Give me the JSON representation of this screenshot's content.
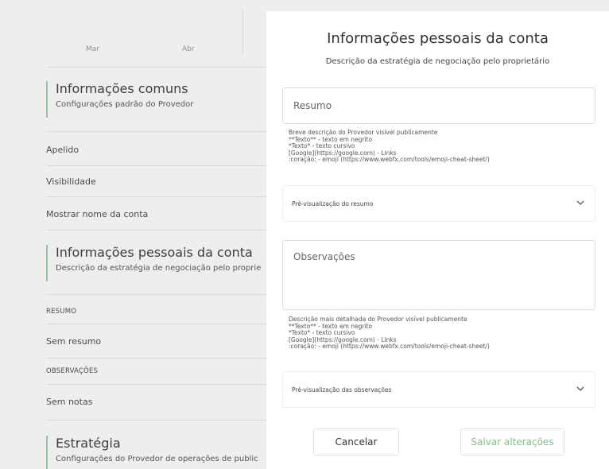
{
  "background": {
    "months": [
      "Mar",
      "Abr"
    ],
    "common": {
      "title": "Informações comuns",
      "subtitle": "Configurações padrão do Provedor"
    },
    "rows": [
      "Apelido",
      "Visibilidade",
      "Mostrar nome da conta"
    ],
    "personal": {
      "title": "Informações pessoais da conta",
      "subtitle": "Descrição da estratégia de negociação pelo proprie"
    },
    "resumo_label": "RESUMO",
    "resumo_value": "Sem resumo",
    "obs_label": "OBSERVAÇÕES",
    "obs_value": "Sem notas",
    "strategy": {
      "title": "Estratégia",
      "subtitle": "Configurações do Provedor de operações de public"
    }
  },
  "modal": {
    "title": "Informações pessoais da conta",
    "subtitle": "Descrição da estratégia de negociação pelo proprietário",
    "summary_placeholder": "Resumo",
    "summary_help": [
      "Breve descrição do Provedor visível publicamente",
      "**Texto** - texto em negrito",
      "*Texto* - texto cursivo",
      "[Google](https://google.com) - Links",
      ":coração: - emoji (https://www.webfx.com/tools/emoji-cheat-sheet/)"
    ],
    "summary_preview": "Pré-visualização do resumo",
    "notes_placeholder": "Observações",
    "notes_help": [
      "Descrição mais detalhada do Provedor visível publicamente",
      "**Texto** - texto em negrito",
      "*Texto* - texto cursivo",
      "[Google](https://google.com) - Links",
      ":coração: - emoji (https://www.webfx.com/tools/emoji-cheat-sheet/)"
    ],
    "notes_preview": "Pré-visualização das observações",
    "cancel": "Cancelar",
    "save": "Salvar alterações"
  },
  "icons": {
    "chevron": "chevron-down-icon"
  },
  "colors": {
    "accent_green": "#7cc08a",
    "section_border": "#8fc79a",
    "overlay_bg": "#eeeeee"
  }
}
